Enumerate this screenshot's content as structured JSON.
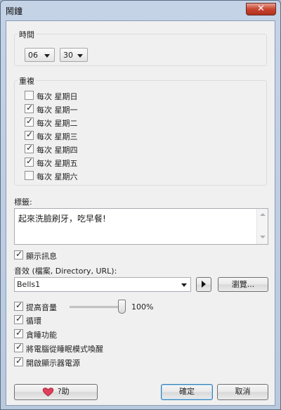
{
  "window": {
    "title": "鬧鐘",
    "close_glyph": "✕"
  },
  "time": {
    "group_title": "時間",
    "hour": "06",
    "minute": "30"
  },
  "repeat": {
    "group_title": "重複",
    "days": [
      {
        "label": "每次 星期日",
        "checked": false
      },
      {
        "label": "每次 星期一",
        "checked": true
      },
      {
        "label": "每次 星期二",
        "checked": true
      },
      {
        "label": "每次 星期三",
        "checked": true
      },
      {
        "label": "每次 星期四",
        "checked": true
      },
      {
        "label": "每次 星期五",
        "checked": true
      },
      {
        "label": "每次 星期六",
        "checked": false
      }
    ]
  },
  "label_section": {
    "caption": "標籤:",
    "text": "起來洗臉刷牙，吃早餐!"
  },
  "show_message": {
    "label": "顯示訊息",
    "checked": true
  },
  "sound": {
    "caption": "音效 (檔案, Directory, URL):",
    "value": "Bells1",
    "browse_label": "瀏覽..."
  },
  "volume": {
    "label": "提高音量",
    "checked": true,
    "level_text": "100%",
    "level": 1.0
  },
  "options": [
    {
      "label": "循環",
      "checked": true
    },
    {
      "label": "貪睡功能",
      "checked": true
    },
    {
      "label": "將電腦從睡眠模式喚醒",
      "checked": true
    },
    {
      "label": "開啟顯示器電源",
      "checked": true
    }
  ],
  "buttons": {
    "help": "?助",
    "ok": "確定",
    "cancel": "取消"
  },
  "colors": {
    "title_bar": "#c4d3e6",
    "close_button": "#c7442f",
    "dialog_bg": "#f0f0f0",
    "default_button_border": "#3c7fb1",
    "help_heart": "#e0405a"
  },
  "icons": {
    "help": "heart-icon",
    "play": "play-icon"
  }
}
